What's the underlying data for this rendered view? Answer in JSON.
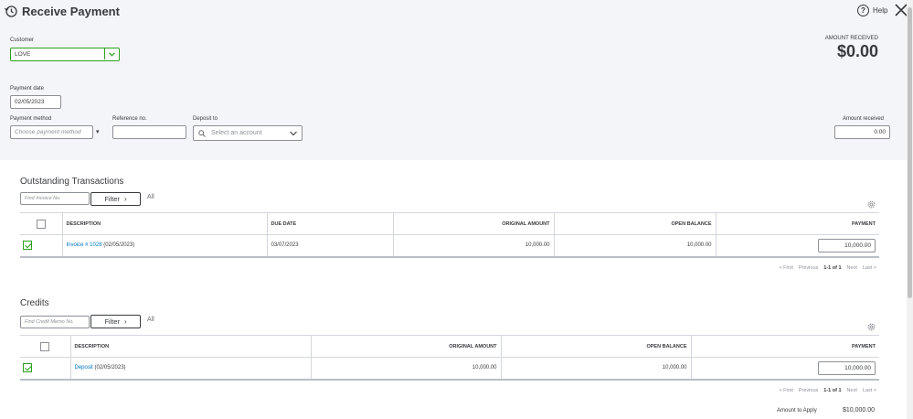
{
  "header": {
    "title": "Receive Payment",
    "help_label": "Help"
  },
  "customer": {
    "label": "Customer",
    "value": "LOVE"
  },
  "amount_received": {
    "label": "AMOUNT RECEIVED",
    "value": "$0.00"
  },
  "payment_date": {
    "label": "Payment date",
    "value": "02/05/2023"
  },
  "payment_method": {
    "label": "Payment method",
    "placeholder": "Choose payment method"
  },
  "reference": {
    "label": "Reference no.",
    "value": ""
  },
  "deposit_to": {
    "label": "Deposit to",
    "placeholder": "Select an account"
  },
  "amount_received_field": {
    "label": "Amount received",
    "value": "0.00"
  },
  "outstanding": {
    "title": "Outstanding Transactions",
    "find_placeholder": "Find Invoice No.",
    "filter_label": "Filter",
    "all_label": "All",
    "columns": [
      "DESCRIPTION",
      "DUE DATE",
      "ORIGINAL AMOUNT",
      "OPEN BALANCE",
      "PAYMENT"
    ],
    "rows": [
      {
        "desc_link": "Invoice # 1028",
        "desc_date": "(02/05/2023)",
        "due_date": "03/07/2023",
        "original": "10,000.00",
        "open": "10,000.00",
        "payment": "10,000.00"
      }
    ],
    "pager": {
      "first": "< First",
      "previous": "Previous",
      "range": "1-1 of 1",
      "next": "Next",
      "last": "Last >"
    }
  },
  "credits": {
    "title": "Credits",
    "find_placeholder": "Find Credit Memo No.",
    "filter_label": "Filter",
    "all_label": "All",
    "columns": [
      "DESCRIPTION",
      "ORIGINAL AMOUNT",
      "OPEN BALANCE",
      "PAYMENT"
    ],
    "rows": [
      {
        "desc_link": "Deposit",
        "desc_date": "(02/05/2023)",
        "original": "10,000.00",
        "open": "10,000.00",
        "payment": "10,000.00"
      }
    ],
    "pager": {
      "first": "< First",
      "previous": "Previous",
      "range": "1-1 of 1",
      "next": "Next",
      "last": "Last >"
    }
  },
  "summary": {
    "amount_to_apply_label": "Amount to Apply",
    "amount_to_apply_value": "$10,000.00"
  },
  "colors": {
    "accent_green": "#2ca01c",
    "link_blue": "#0077c5",
    "header_bg": "#f4f5f8"
  }
}
